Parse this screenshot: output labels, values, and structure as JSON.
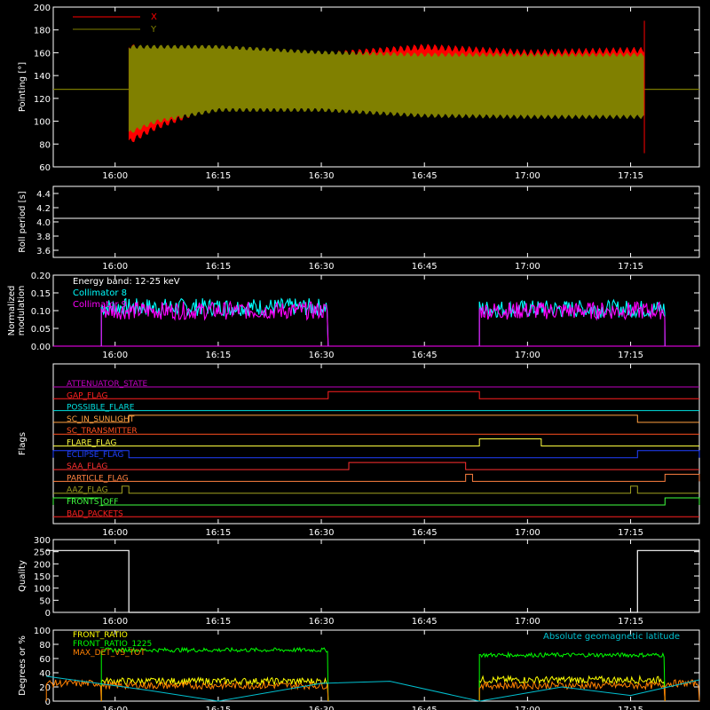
{
  "chart_data": [
    {
      "type": "line",
      "id": "pointing",
      "ylabel": "Pointing [°]",
      "ylim": [
        60,
        200
      ],
      "yticks": [
        60,
        80,
        100,
        120,
        140,
        160,
        180,
        200
      ],
      "legend": [
        "X",
        "Y"
      ],
      "series": [
        {
          "name": "X",
          "color": "#ff0000",
          "x_start": "16:02",
          "x_end": "17:17",
          "min_range": [
            80,
            122
          ],
          "max_range": [
            128,
            168
          ],
          "steady": 128,
          "envelope": [
            [
              "16:02",
              82,
              166
            ],
            [
              "16:06",
              95,
              158
            ],
            [
              "16:15",
              115,
              140
            ],
            [
              "16:30",
              122,
              158
            ],
            [
              "16:45",
              125,
              165
            ],
            [
              "17:00",
              122,
              160
            ],
            [
              "17:15",
              120,
              162
            ]
          ]
        },
        {
          "name": "Y",
          "color": "#808000",
          "x_start": "16:02",
          "x_end": "17:17",
          "steady": 128,
          "envelope": [
            [
              "16:02",
              90,
              165
            ],
            [
              "16:06",
              100,
              165
            ],
            [
              "16:15",
              110,
              165
            ],
            [
              "16:30",
              110,
              160
            ],
            [
              "16:45",
              105,
              158
            ],
            [
              "17:00",
              104,
              158
            ],
            [
              "17:15",
              104,
              158
            ]
          ]
        }
      ]
    },
    {
      "type": "line",
      "id": "roll",
      "ylabel": "Roll period [s]",
      "ylim": [
        3.5,
        4.5
      ],
      "yticks": [
        3.6,
        3.8,
        4.0,
        4.2,
        4.4
      ],
      "series": [
        {
          "color": "#ffffff",
          "value": 4.05
        }
      ]
    },
    {
      "type": "line",
      "id": "modulation",
      "ylabel": "Normalized modulation",
      "ylim": [
        0,
        0.2
      ],
      "yticks": [
        0.0,
        0.05,
        0.1,
        0.15,
        0.2
      ],
      "annotation": "Energy band: 12-25 keV",
      "series": [
        {
          "name": "Collimator 8",
          "color": "#00ffff",
          "intervals": [
            [
              "15:58",
              "16:31",
              0.11
            ],
            [
              "16:53",
              "17:20",
              0.105
            ]
          ]
        },
        {
          "name": "Collimator 9",
          "color": "#ff00ff",
          "intervals": [
            [
              "15:58",
              "16:31",
              0.1
            ],
            [
              "16:53",
              "17:20",
              0.1
            ]
          ]
        }
      ]
    },
    {
      "type": "line",
      "id": "flags",
      "ylabel": "Flags",
      "flags": [
        {
          "name": "ATTENUATOR_STATE",
          "color": "#c000c0",
          "on": []
        },
        {
          "name": "GAP_FLAG",
          "color": "#ff2020",
          "on": [
            [
              "16:31",
              "16:53"
            ]
          ]
        },
        {
          "name": "POSSIBLE_FLARE",
          "color": "#00e0e0",
          "on": []
        },
        {
          "name": "SC_IN_SUNLIGHT",
          "color": "#ffa040",
          "on": [
            [
              "16:02",
              "17:16"
            ]
          ]
        },
        {
          "name": "SC_TRANSMITTER",
          "color": "#ff5020",
          "on": []
        },
        {
          "name": "FLARE_FLAG",
          "color": "#ffff40",
          "on": [
            [
              "16:53",
              "17:02"
            ]
          ]
        },
        {
          "name": "ECLIPSE_FLAG",
          "color": "#2040ff",
          "on": [
            [
              "15:50",
              "16:02"
            ],
            [
              "17:16",
              "17:25"
            ]
          ]
        },
        {
          "name": "SAA_FLAG",
          "color": "#ff3030",
          "on": [
            [
              "16:34",
              "16:51"
            ]
          ]
        },
        {
          "name": "PARTICLE_FLAG",
          "color": "#ff8040",
          "on": [
            [
              "16:51",
              "16:52"
            ],
            [
              "17:20",
              "17:25"
            ]
          ]
        },
        {
          "name": "AAZ_FLAG",
          "color": "#a0a020",
          "on": [
            [
              "16:01",
              "16:02"
            ],
            [
              "17:15",
              "17:16"
            ]
          ]
        },
        {
          "name": "FRONTS_OFF",
          "color": "#40ff40",
          "on": [
            [
              "15:50",
              "15:58"
            ],
            [
              "17:20",
              "17:25"
            ]
          ]
        },
        {
          "name": "BAD_PACKETS",
          "color": "#ff2020",
          "on": []
        }
      ]
    },
    {
      "type": "line",
      "id": "quality",
      "ylabel": "Quality",
      "ylim": [
        0,
        300
      ],
      "yticks": [
        0,
        50,
        100,
        150,
        200,
        250,
        300
      ],
      "series": [
        {
          "color": "#ffffff",
          "intervals": [
            [
              "15:50",
              "16:02",
              255
            ],
            [
              "16:02",
              "17:16",
              0
            ],
            [
              "17:16",
              "17:25",
              255
            ]
          ]
        }
      ]
    },
    {
      "type": "line",
      "id": "ratios",
      "ylabel": "Degrees or %",
      "ylim": [
        0,
        100
      ],
      "yticks": [
        0,
        20,
        40,
        60,
        80,
        100
      ],
      "series": [
        {
          "name": "FRONT_RATIO",
          "color": "#ffff00",
          "intervals": [
            [
              "15:58",
              "16:31",
              28
            ],
            [
              "16:53",
              "17:20",
              30
            ]
          ]
        },
        {
          "name": "FRONT_RATIO_1225",
          "color": "#00ff00",
          "intervals": [
            [
              "15:58",
              "16:31",
              72
            ],
            [
              "16:53",
              "17:20",
              65
            ]
          ]
        },
        {
          "name": "MAX_DET_VS_TOT",
          "color": "#ff8000",
          "intervals": [
            [
              "15:50",
              "15:58",
              25
            ],
            [
              "15:58",
              "16:31",
              22
            ],
            [
              "16:53",
              "17:20",
              22
            ],
            [
              "17:20",
              "17:25",
              25
            ]
          ]
        },
        {
          "name": "Absolute geomagnetic latitude",
          "color": "#00c0d0",
          "points": [
            [
              "15:50",
              35
            ],
            [
              "16:05",
              15
            ],
            [
              "16:15",
              0
            ],
            [
              "16:30",
              25
            ],
            [
              "16:40",
              28
            ],
            [
              "16:53",
              0
            ],
            [
              "17:05",
              20
            ],
            [
              "17:15",
              8
            ],
            [
              "17:25",
              30
            ]
          ]
        }
      ]
    }
  ],
  "x_axis": {
    "range": [
      "15:51",
      "17:25"
    ],
    "ticks": [
      "16:00",
      "16:15",
      "16:30",
      "16:45",
      "17:00",
      "17:15"
    ]
  }
}
